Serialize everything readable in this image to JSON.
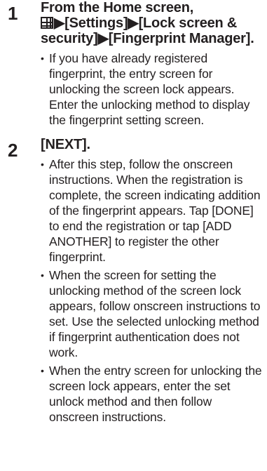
{
  "steps": [
    {
      "number": "1",
      "title_part1": "From the Home screen,",
      "title_part2": "▶[Settings]▶[Lock screen & security]▶[Fingerprint Manager].",
      "icon": "apps-grid-icon",
      "bullets": [
        "If you have already registered fingerprint, the entry screen for unlocking the screen lock appears. Enter the unlocking method to display the fingerprint setting screen."
      ]
    },
    {
      "number": "2",
      "title": "[NEXT].",
      "bullets": [
        "After this step, follow the onscreen instructions. When the registration is complete, the screen indicating addition of the fingerprint appears. Tap [DONE] to end the registration or tap [ADD ANOTHER] to register the other fingerprint.",
        "When the screen for setting the unlocking method of the screen lock appears, follow onscreen instructions to set. Use the selected unlocking method if fingerprint authentication does not work.",
        "When the entry screen for unlocking the screen lock appears, enter the set unlock method and then follow onscreen instructions."
      ]
    }
  ]
}
